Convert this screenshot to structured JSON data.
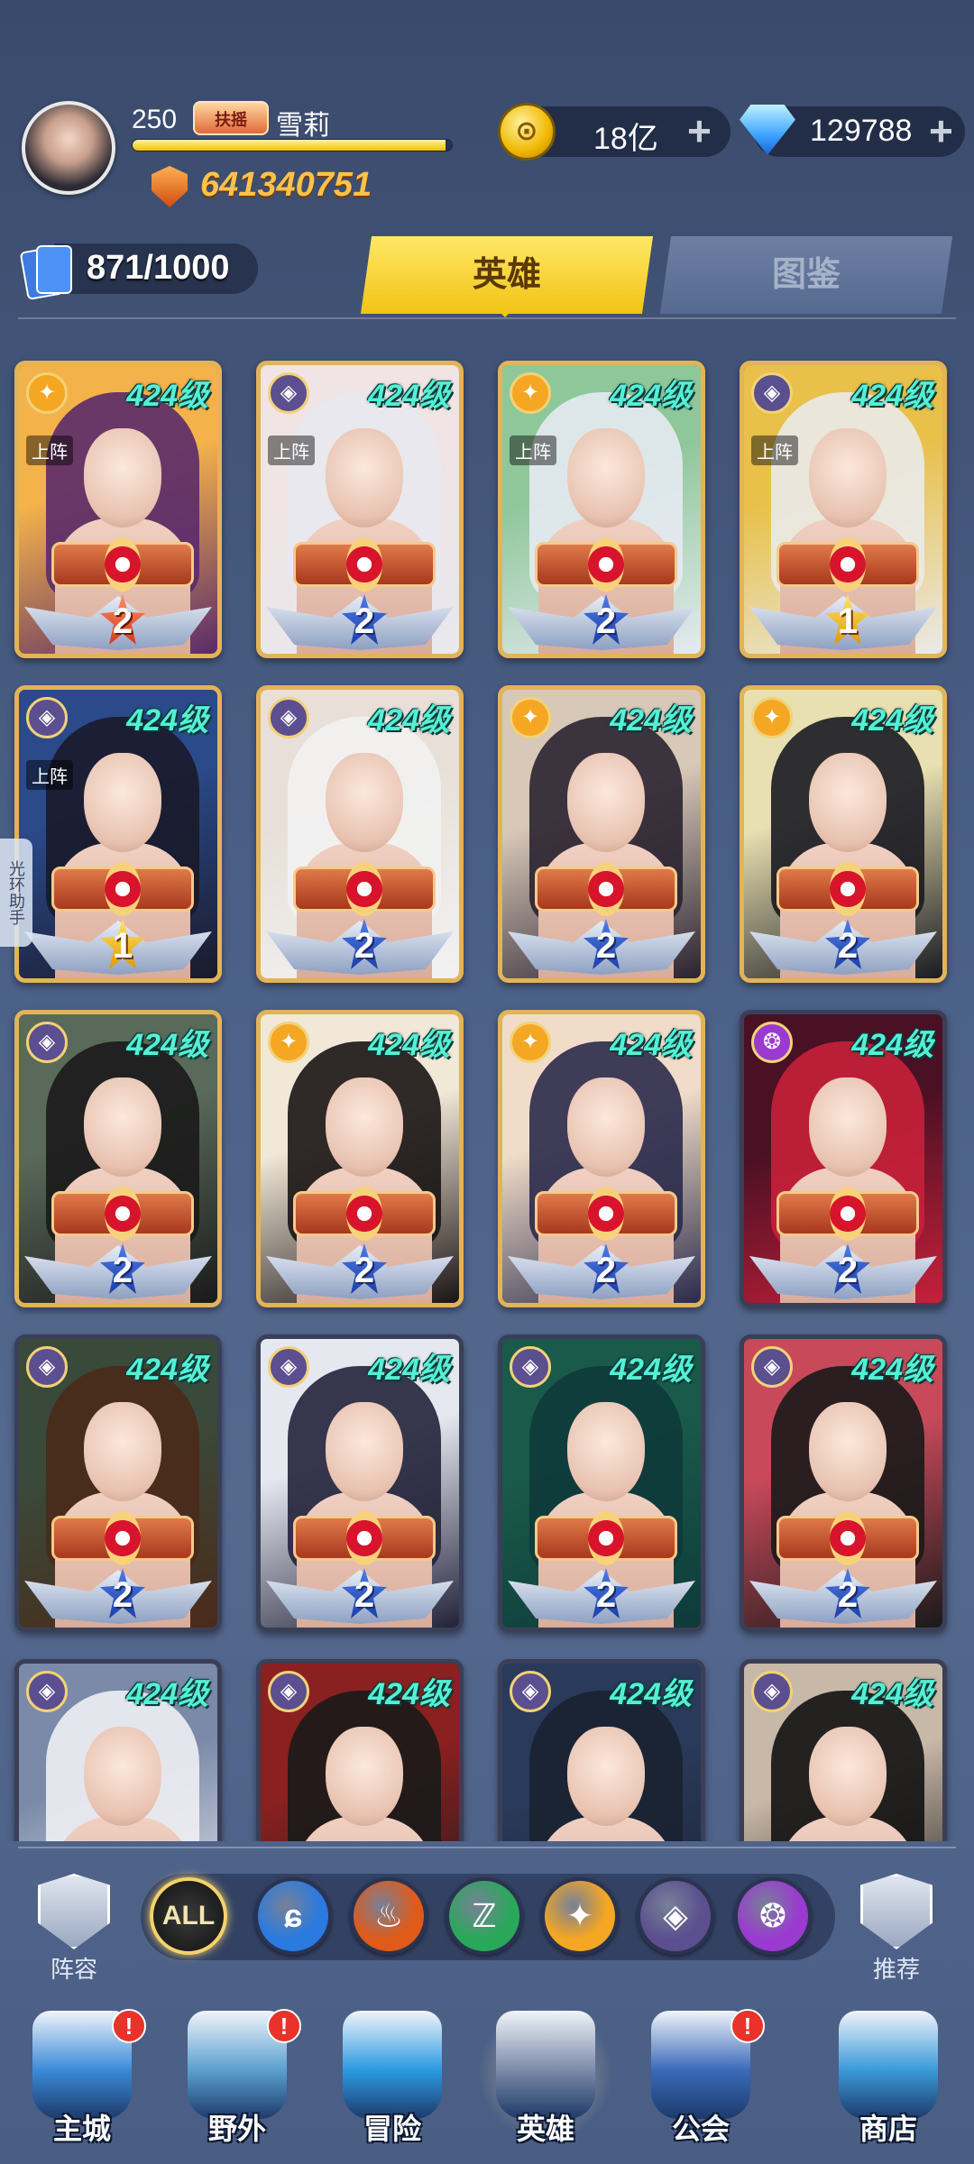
{
  "player": {
    "level": "250",
    "vip_label": "扶摇",
    "name": "雪莉",
    "exp_fraction": 0.98,
    "power": "641340751"
  },
  "resources": {
    "gold": "18亿",
    "diamonds": "129788",
    "plus": "+"
  },
  "collection": {
    "count": "871/1000"
  },
  "tabs": {
    "heroes": "英雄",
    "gallery": "图鉴",
    "active": "heroes"
  },
  "deployed_label": "上阵",
  "side_helper": "光环助手",
  "heroes": [
    {
      "level": "424级",
      "faction": "light",
      "deployed": true,
      "stars": "2",
      "frame": "gold",
      "star_style": "red",
      "colors": [
        "#f4b24a",
        "#5a2a6a"
      ]
    },
    {
      "level": "424级",
      "faction": "void",
      "deployed": true,
      "stars": "2",
      "frame": "gold",
      "star_style": "blue",
      "colors": [
        "#f0e4e4",
        "#e8e8ee"
      ]
    },
    {
      "level": "424级",
      "faction": "light",
      "deployed": true,
      "stars": "2",
      "frame": "gold",
      "star_style": "blue",
      "colors": [
        "#8ec79a",
        "#e6eaf2"
      ]
    },
    {
      "level": "424级",
      "faction": "void",
      "deployed": true,
      "stars": "1",
      "frame": "gold",
      "star_style": "gold",
      "colors": [
        "#e8c04a",
        "#eaeaea"
      ]
    },
    {
      "level": "424级",
      "faction": "void",
      "deployed": true,
      "stars": "1",
      "frame": "gold",
      "star_style": "gold",
      "colors": [
        "#2a4a8a",
        "#1a1a2a"
      ]
    },
    {
      "level": "424级",
      "faction": "void",
      "deployed": false,
      "stars": "2",
      "frame": "gold",
      "star_style": "blue",
      "colors": [
        "#e8e0d8",
        "#f2f2f2"
      ]
    },
    {
      "level": "424级",
      "faction": "light",
      "deployed": false,
      "stars": "2",
      "frame": "gold",
      "star_style": "blue",
      "colors": [
        "#d8c8b8",
        "#2a2230"
      ]
    },
    {
      "level": "424级",
      "faction": "light",
      "deployed": false,
      "stars": "2",
      "frame": "gold",
      "star_style": "blue",
      "colors": [
        "#e8e0b0",
        "#1a1a22"
      ]
    },
    {
      "level": "424级",
      "faction": "void",
      "deployed": false,
      "stars": "2",
      "frame": "gold",
      "star_style": "blue",
      "colors": [
        "#5a6a5a",
        "#1a1a1a"
      ]
    },
    {
      "level": "424级",
      "faction": "light",
      "deployed": false,
      "stars": "2",
      "frame": "gold",
      "star_style": "blue",
      "colors": [
        "#f2e8d8",
        "#1a1414"
      ]
    },
    {
      "level": "424级",
      "faction": "light",
      "deployed": false,
      "stars": "2",
      "frame": "gold",
      "star_style": "blue",
      "colors": [
        "#f0dcc8",
        "#2a2a4a"
      ]
    },
    {
      "level": "424级",
      "faction": "arcane",
      "deployed": false,
      "stars": "2",
      "frame": "purple",
      "star_style": "blue",
      "colors": [
        "#4a1024",
        "#c8203a"
      ]
    },
    {
      "level": "424级",
      "faction": "void",
      "deployed": false,
      "stars": "2",
      "frame": "purple",
      "star_style": "blue",
      "colors": [
        "#3a4a3a",
        "#4a2a1a"
      ]
    },
    {
      "level": "424级",
      "faction": "void",
      "deployed": false,
      "stars": "2",
      "frame": "purple",
      "star_style": "blue",
      "colors": [
        "#e6e8f0",
        "#22223a"
      ]
    },
    {
      "level": "424级",
      "faction": "void",
      "deployed": false,
      "stars": "2",
      "frame": "purple",
      "star_style": "blue",
      "colors": [
        "#1a5a4a",
        "#0e3a3a"
      ]
    },
    {
      "level": "424级",
      "faction": "void",
      "deployed": false,
      "stars": "2",
      "frame": "purple",
      "star_style": "blue",
      "colors": [
        "#c84a5a",
        "#1a1a1a"
      ]
    },
    {
      "level": "424级",
      "faction": "void",
      "deployed": false,
      "stars": "",
      "frame": "purple",
      "star_style": "blue",
      "colors": [
        "#7a8aa8",
        "#f0f0f4"
      ]
    },
    {
      "level": "424级",
      "faction": "void",
      "deployed": false,
      "stars": "",
      "frame": "purple",
      "star_style": "blue",
      "colors": [
        "#8a2020",
        "#1a1a1a"
      ]
    },
    {
      "level": "424级",
      "faction": "void",
      "deployed": false,
      "stars": "",
      "frame": "purple",
      "star_style": "blue",
      "colors": [
        "#2a3a5a",
        "#1a2230"
      ]
    },
    {
      "level": "424级",
      "faction": "void",
      "deployed": false,
      "stars": "",
      "frame": "purple",
      "star_style": "blue",
      "colors": [
        "#c8b8a8",
        "#121212"
      ]
    }
  ],
  "faction_colors": {
    "light": "#f5a623",
    "void": "#5b4f8f",
    "arcane": "#9a3ad0"
  },
  "filters": {
    "lineup_label": "阵容",
    "recommend_label": "推荐",
    "all_label": "ALL",
    "factions": [
      {
        "name": "all",
        "color": "#111111"
      },
      {
        "name": "water",
        "color": "#2a7ae0",
        "glyph": "ɕ"
      },
      {
        "name": "fire",
        "color": "#e05a1a",
        "glyph": "♨"
      },
      {
        "name": "wind",
        "color": "#2aa85a",
        "glyph": "ℤ"
      },
      {
        "name": "light",
        "color": "#f5a623",
        "glyph": "✦"
      },
      {
        "name": "void",
        "color": "#5b4f8f",
        "glyph": "◈"
      },
      {
        "name": "arcane",
        "color": "#9a3ad0",
        "glyph": "❂"
      }
    ]
  },
  "nav": [
    {
      "key": "main-city",
      "label": "主城",
      "badge": "!",
      "color": "#3a8ad8"
    },
    {
      "key": "wild",
      "label": "野外",
      "badge": "!",
      "color": "#5aa0d0"
    },
    {
      "key": "adventure",
      "label": "冒险",
      "badge": "",
      "color": "#2a9ae0"
    },
    {
      "key": "hero",
      "label": "英雄",
      "badge": "",
      "color": "#7a8aa8",
      "active": true
    },
    {
      "key": "guild",
      "label": "公会",
      "badge": "!",
      "color": "#3a6ab8"
    },
    {
      "key": "shop",
      "label": "商店",
      "badge": "",
      "color": "#3a9ad8"
    }
  ]
}
